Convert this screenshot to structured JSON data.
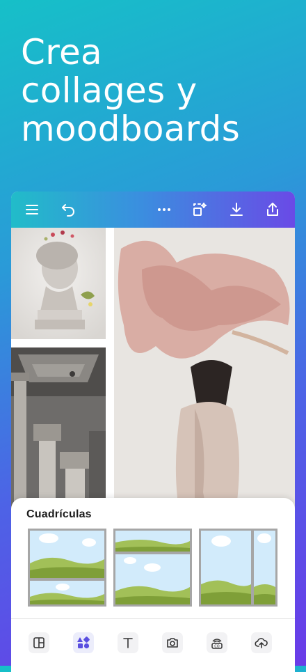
{
  "headline": "Crea\ncollages y\nmoodboards",
  "toolbar": {
    "icons": [
      "menu-icon",
      "undo-icon",
      "more-icon",
      "magic-resize-icon",
      "download-icon",
      "share-icon"
    ]
  },
  "sheet": {
    "title": "Cuadrículas",
    "layouts": [
      "grid-layout-two-rows",
      "grid-layout-three-rows",
      "grid-layout-two-columns"
    ]
  },
  "bottom_nav": {
    "items": [
      "layout-icon",
      "elements-icon",
      "text-icon",
      "camera-icon",
      "brand-icon",
      "upload-cloud-icon"
    ],
    "active": "elements-icon"
  },
  "colors": {
    "accent": "#5a4fe0",
    "toolbar_start": "#21bcc9",
    "toolbar_end": "#6a4ae6",
    "sky": "#d2ebfb",
    "hill_light": "#a2c058",
    "hill_dark": "#7f9f38"
  }
}
